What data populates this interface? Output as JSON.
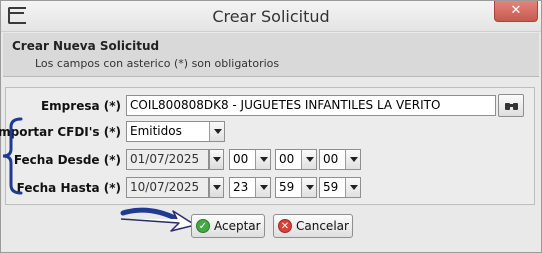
{
  "window": {
    "title": "Crear Solicitud",
    "close_label": "✕"
  },
  "header": {
    "title": "Crear Nueva Solicitud",
    "subtitle": "Los campos con asterico (*) son obligatorios"
  },
  "form": {
    "empresa": {
      "label": "Empresa (*)",
      "value": "COIL800808DK8 - JUGUETES INFANTILES LA VERITO"
    },
    "importar": {
      "label": "Importar CFDI's (*)",
      "value": "Emitidos"
    },
    "fecha_desde": {
      "label": "Fecha Desde (*)",
      "date": "01/07/2025",
      "hour": "00",
      "minute": "00",
      "second": "00"
    },
    "fecha_hasta": {
      "label": "Fecha Hasta (*)",
      "date": "10/07/2025",
      "hour": "23",
      "minute": "59",
      "second": "59"
    }
  },
  "buttons": {
    "accept": "Aceptar",
    "cancel": "Cancelar"
  },
  "colors": {
    "annotation": "#1f3a93",
    "close": "#c75a4f",
    "accept_icon": "#45a845",
    "cancel_icon": "#d8413a"
  },
  "icons": {
    "app": "window-icon",
    "lookup": "binoculars-icon",
    "accept": "check-circle-icon",
    "cancel": "x-circle-icon"
  }
}
